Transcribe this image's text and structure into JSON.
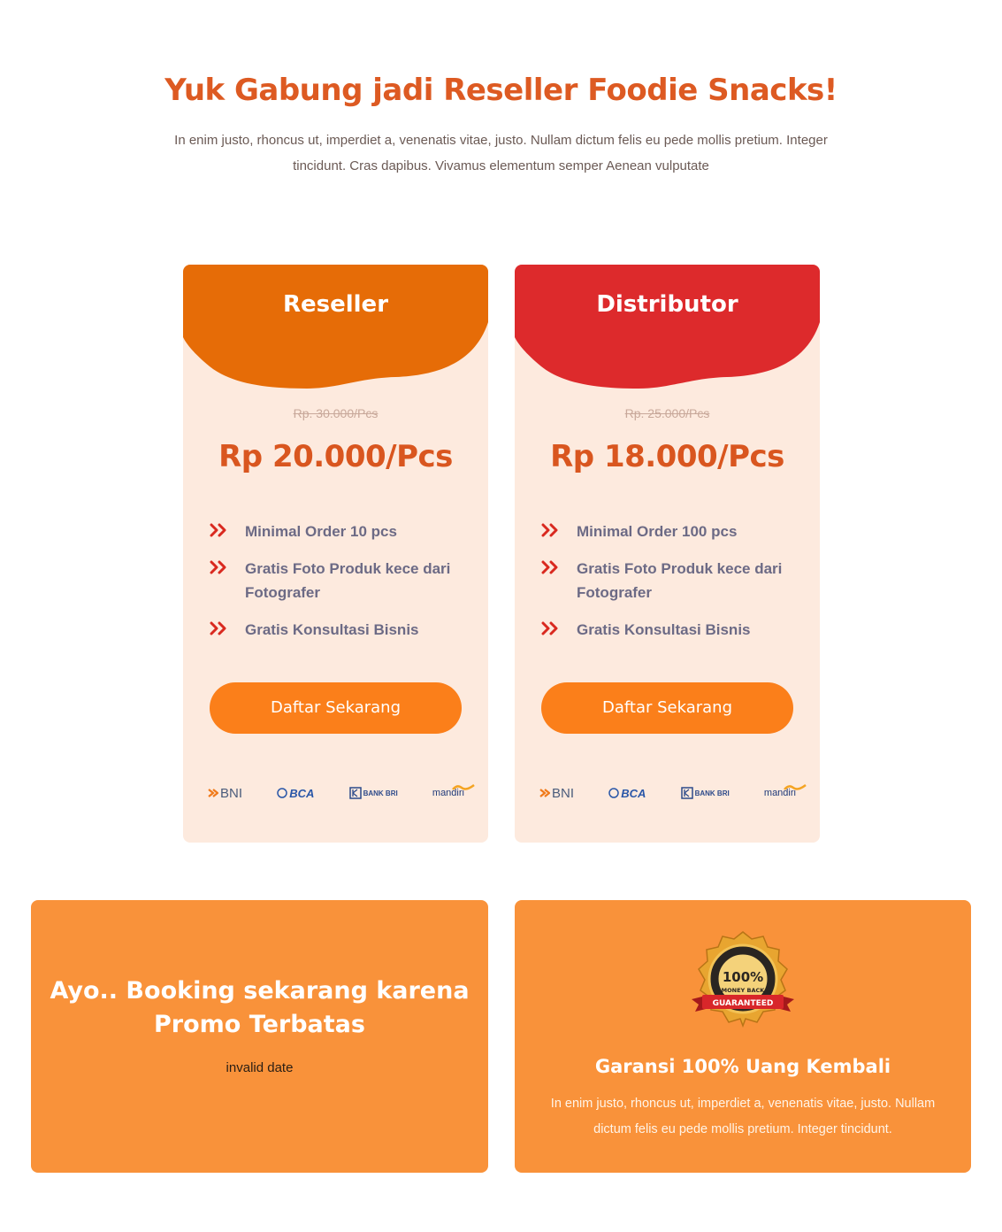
{
  "header": {
    "title": "Yuk Gabung jadi Reseller Foodie Snacks!",
    "subtitle": "In enim justo, rhoncus ut, imperdiet a, venenatis vitae, justo. Nullam dictum felis eu pede mollis pretium. Integer tincidunt. Cras dapibus. Vivamus elementum semper Aenean vulputate"
  },
  "plans": [
    {
      "name": "Reseller",
      "old_price": "Rp. 30.000/Pcs",
      "price": "Rp 20.000/Pcs",
      "features": [
        "Minimal Order 10 pcs",
        "Gratis Foto Produk kece dari Fotografer",
        "Gratis Konsultasi Bisnis"
      ],
      "button": "Daftar Sekarang",
      "color": "#e66c07"
    },
    {
      "name": "Distributor",
      "old_price": "Rp. 25.000/Pcs",
      "price": "Rp 18.000/Pcs",
      "features": [
        "Minimal Order 100 pcs",
        "Gratis Foto Produk kece dari Fotografer",
        "Gratis Konsultasi Bisnis"
      ],
      "button": "Daftar Sekarang",
      "color": "#dd2a2c"
    }
  ],
  "banks": [
    "BNI",
    "BCA",
    "BANK BRI",
    "mandiri"
  ],
  "promo": {
    "title": "Ayo.. Booking sekarang karena Promo Terbatas",
    "date": "invalid date"
  },
  "guarantee": {
    "badge_top": "100%",
    "badge_middle": "MONEY BACK",
    "badge_ribbon": "GUARANTEED",
    "title": "Garansi 100% Uang Kembali",
    "text": "In enim justo, rhoncus ut, imperdiet a, venenatis vitae, justo. Nullam dictum felis eu pede mollis pretium. Integer tincidunt."
  },
  "colors": {
    "accent": "#dd5a22",
    "button": "#fb7f1a",
    "card_bg": "#fdeade",
    "promo_bg": "#f9923a",
    "chevron": "#d9291f"
  }
}
